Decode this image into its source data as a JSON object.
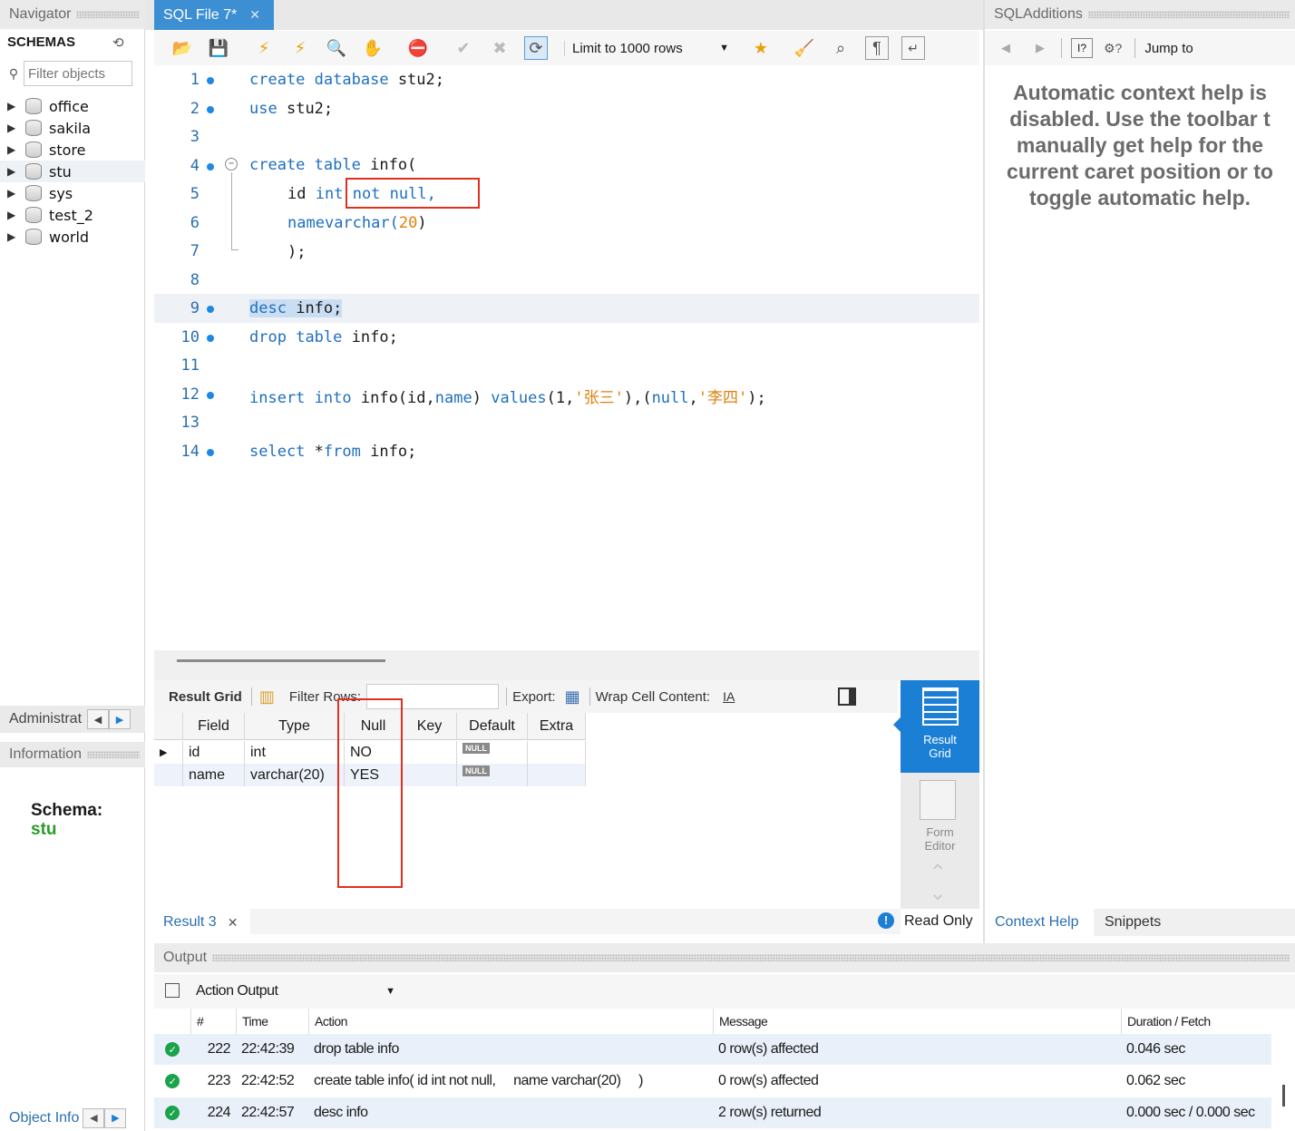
{
  "navigator": {
    "title": "Navigator",
    "schemas_label": "SCHEMAS",
    "filter_placeholder": "Filter objects",
    "schemas": [
      "office",
      "sakila",
      "store",
      "stu",
      "sys",
      "test_2",
      "world"
    ],
    "administration_label": "Administrat",
    "information_label": "Information",
    "schema_key": "Schema:",
    "schema_value": "stu",
    "object_info_label": "Object Info"
  },
  "editor": {
    "tab_label": "SQL File 7*",
    "limit_label": "Limit to 1000 rows",
    "lines": [
      {
        "n": "1",
        "dot": true
      },
      {
        "n": "2",
        "dot": true
      },
      {
        "n": "3",
        "dot": false
      },
      {
        "n": "4",
        "dot": true
      },
      {
        "n": "5",
        "dot": false
      },
      {
        "n": "6",
        "dot": false
      },
      {
        "n": "7",
        "dot": false
      },
      {
        "n": "8",
        "dot": false
      },
      {
        "n": "9",
        "dot": true
      },
      {
        "n": "10",
        "dot": true
      },
      {
        "n": "11",
        "dot": false
      },
      {
        "n": "12",
        "dot": true
      },
      {
        "n": "13",
        "dot": false
      },
      {
        "n": "14",
        "dot": true
      }
    ],
    "code": {
      "l1": [
        "create",
        "database",
        "stu2;"
      ],
      "l2": [
        "use",
        "stu2;"
      ],
      "l4": [
        "create",
        "table",
        "info("
      ],
      "l5": [
        "id",
        "int",
        "not",
        "null,"
      ],
      "l6": [
        "name",
        "varchar(",
        "20",
        ")"
      ],
      "l7": ");",
      "l9": [
        "desc",
        "info;"
      ],
      "l10": [
        "drop",
        "table",
        "info;"
      ],
      "l12": [
        "insert",
        "into",
        "info(id,",
        "name",
        ")",
        "values",
        "(1,",
        "'张三'",
        "),(",
        "null",
        ",",
        "'李四'",
        ");"
      ],
      "l14": [
        "select",
        "*",
        "from",
        "info;"
      ]
    }
  },
  "result": {
    "toolbar": {
      "result_grid": "Result Grid",
      "filter_rows": "Filter Rows:",
      "export": "Export:",
      "wrap": "Wrap Cell Content:"
    },
    "columns": [
      "Field",
      "Type",
      "Null",
      "Key",
      "Default",
      "Extra"
    ],
    "rows": [
      {
        "field": "id",
        "type": "int",
        "null": "NO",
        "key": "",
        "default": "NULL",
        "extra": ""
      },
      {
        "field": "name",
        "type": "varchar(20)",
        "null": "YES",
        "key": "",
        "default": "NULL",
        "extra": ""
      }
    ],
    "result_tab": "Result 3",
    "read_only": "Read Only",
    "side_result_grid": [
      "Result",
      "Grid"
    ],
    "side_form_editor": [
      "Form",
      "Editor"
    ]
  },
  "sql_additions": {
    "title": "SQLAdditions",
    "jump_to": "Jump to",
    "help_text": [
      "Automatic context help is",
      "disabled. Use the toolbar t",
      "manually get help for the",
      "current caret position or to",
      "toggle automatic help."
    ],
    "tab_context_help": "Context Help",
    "tab_snippets": "Snippets"
  },
  "output": {
    "title": "Output",
    "dropdown": "Action Output",
    "columns": [
      "#",
      "Time",
      "Action",
      "Message",
      "Duration / Fetch"
    ],
    "rows": [
      {
        "num": "222",
        "time": "22:42:39",
        "action": "drop table info",
        "message": "0 row(s) affected",
        "duration": "0.046 sec"
      },
      {
        "num": "223",
        "time": "22:42:52",
        "action": "create table info( id int not null,     name varchar(20)     )",
        "message": "0 row(s) affected",
        "duration": "0.062 sec"
      },
      {
        "num": "224",
        "time": "22:42:57",
        "action": "desc info",
        "message": "2 row(s) returned",
        "duration": "0.000 sec / 0.000 sec"
      }
    ]
  },
  "colors": {
    "accent": "#1c7fd6",
    "keyword": "#1f6fbf",
    "string": "#e0800c",
    "highlight": "#e0301e",
    "success": "#1aa34a"
  }
}
